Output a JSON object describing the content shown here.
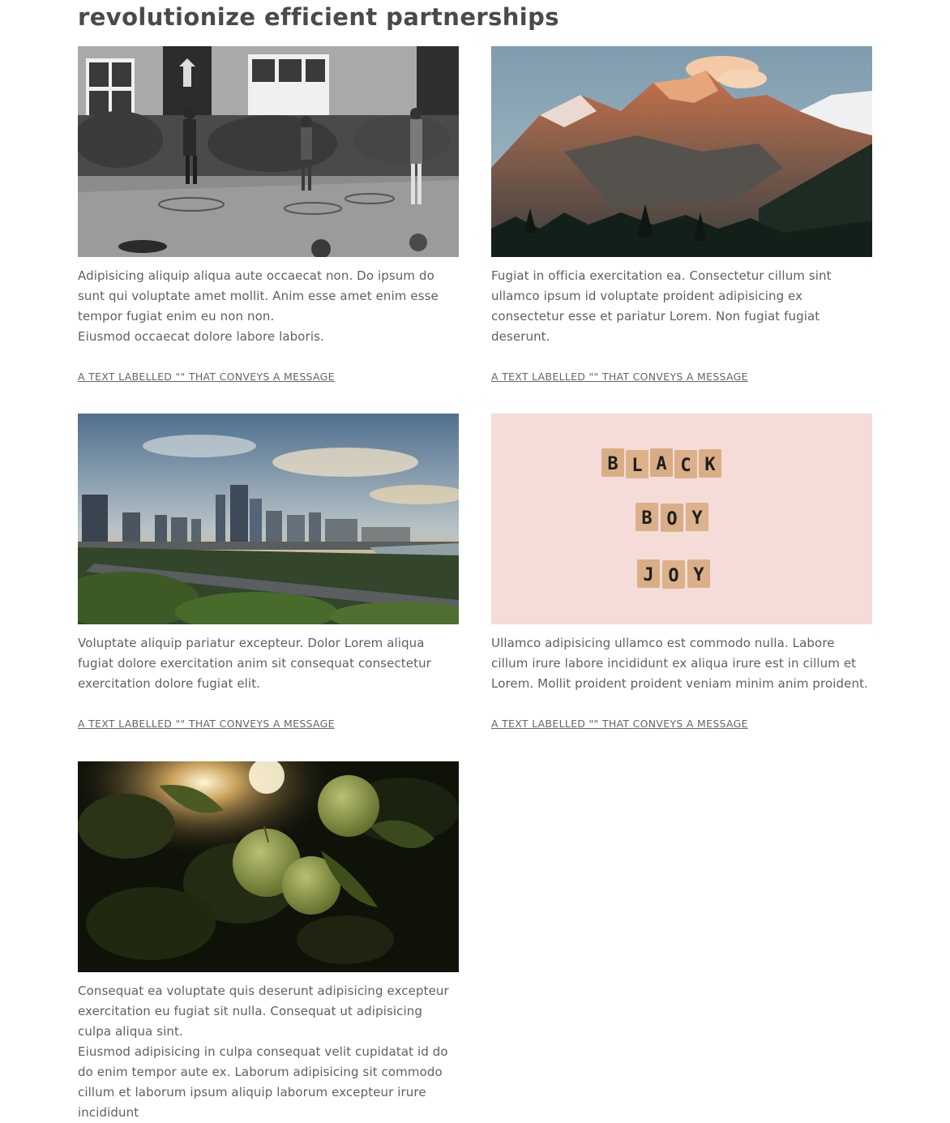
{
  "page_title": "revolutionize efficient partnerships",
  "cards": [
    {
      "image_subject": "schoolyard-play-photo",
      "description": [
        "Adipisicing aliquip aliqua aute occaecat non. Do ipsum do sunt qui voluptate amet mollit. Anim esse amet enim esse tempor fugiat enim eu non non.",
        "Eiusmod occaecat dolore labore laboris."
      ],
      "link_label": "A TEXT LABELLED \"\" THAT CONVEYS A MESSAGE"
    },
    {
      "image_subject": "mountain-sunset-photo",
      "description": [
        "Fugiat in officia exercitation ea. Consectetur cillum sint ullamco ipsum id voluptate proident adipisicing ex consectetur esse et pariatur Lorem. Non fugiat fugiat deserunt."
      ],
      "link_label": "A TEXT LABELLED \"\" THAT CONVEYS A MESSAGE"
    },
    {
      "image_subject": "city-skyline-photo",
      "description": [
        "Voluptate aliquip pariatur excepteur. Dolor Lorem aliqua fugiat dolore exercitation anim sit consequat consectetur exercitation dolore fugiat elit."
      ],
      "link_label": "A TEXT LABELLED \"\" THAT CONVEYS A MESSAGE"
    },
    {
      "image_subject": "letter-tiles-photo",
      "image_text": [
        "BLACK",
        "BOY",
        "JOY"
      ],
      "description": [
        "Ullamco adipisicing ullamco est commodo nulla. Labore cillum irure labore incididunt ex aliqua irure est in cillum et Lorem. Mollit proident proident veniam minim anim proident."
      ],
      "link_label": "A TEXT LABELLED \"\" THAT CONVEYS A MESSAGE"
    },
    {
      "image_subject": "green-apples-photo",
      "description": [
        "Consequat ea voluptate quis deserunt adipisicing excepteur exercitation eu fugiat sit nulla. Consequat ut adipisicing culpa aliqua sint.",
        "Eiusmod adipisicing in culpa consequat velit cupidatat id do do enim tempor aute ex. Laborum adipisicing sit commodo cillum et laborum ipsum aliquip laborum excepteur irure incididunt"
      ]
    }
  ]
}
